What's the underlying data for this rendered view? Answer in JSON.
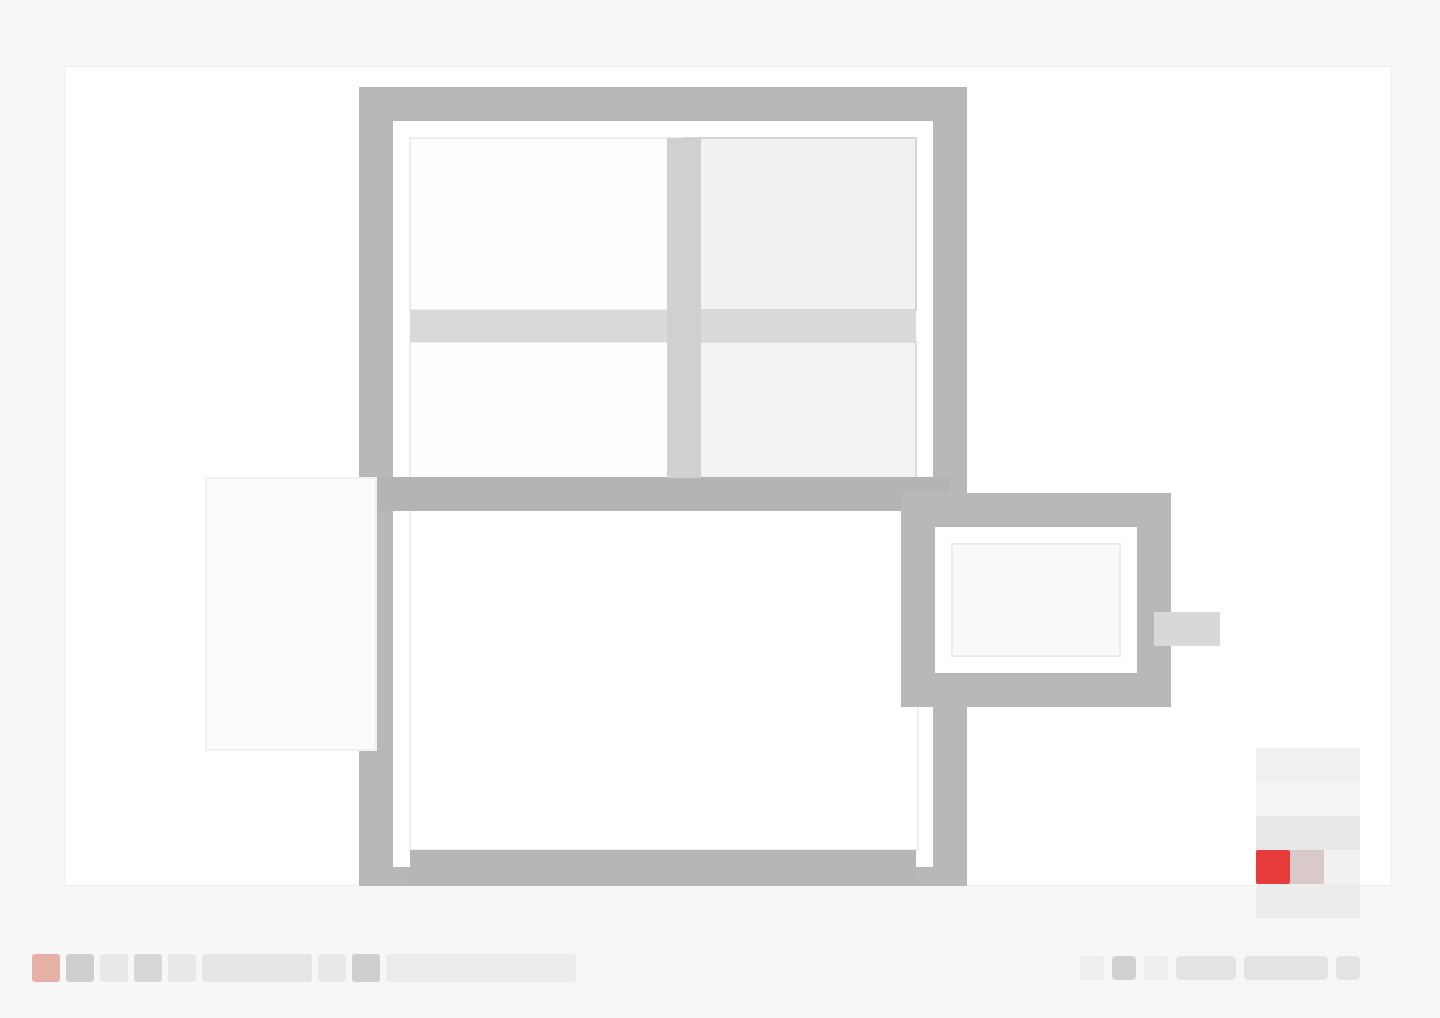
{
  "app": {
    "title": ""
  },
  "canvas": {
    "shapes": [
      {
        "name": "main-outline"
      },
      {
        "name": "side-box"
      }
    ]
  },
  "controls": {
    "left": [
      "color-swatch",
      "tool-1",
      "tool-2",
      "tool-3",
      "tool-4",
      "tool-5",
      "tool-6",
      "tool-7",
      "tool-8"
    ],
    "right": [
      "zoom-out",
      "zoom-level",
      "zoom-in",
      "fit",
      "settings"
    ]
  },
  "colors": {
    "accent": "#e53b3b",
    "outline": "#b7b7b7",
    "outline_dark": "#a6a6a6",
    "panel": "#ffffff",
    "background": "#f7f7f7"
  }
}
